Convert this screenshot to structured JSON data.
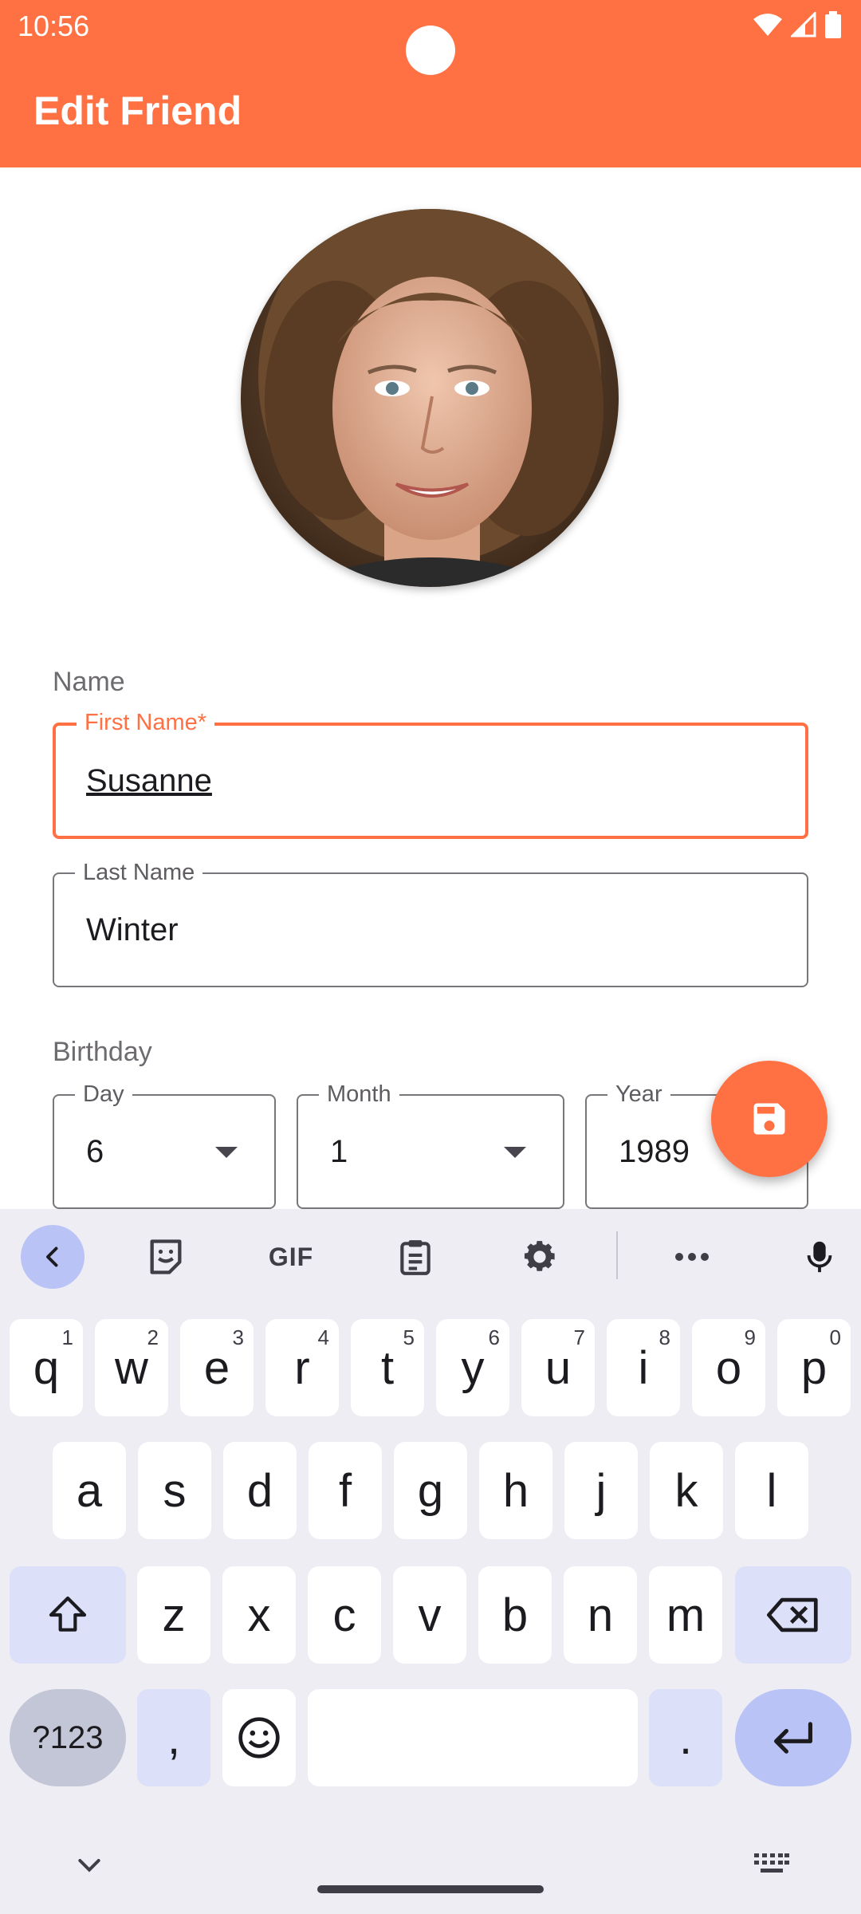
{
  "status_bar": {
    "time": "10:56"
  },
  "app_bar": {
    "title": "Edit Friend"
  },
  "form": {
    "name_section": "Name",
    "first_name": {
      "label": "First Name*",
      "value": "Susanne"
    },
    "last_name": {
      "label": "Last Name",
      "value": "Winter"
    },
    "birthday_section": "Birthday",
    "day": {
      "label": "Day",
      "value": "6"
    },
    "month": {
      "label": "Month",
      "value": "1"
    },
    "year": {
      "label": "Year",
      "value": "1989"
    }
  },
  "fab": {
    "icon": "save-icon"
  },
  "keyboard": {
    "toolbar": {
      "gif": "GIF"
    },
    "row1": [
      {
        "k": "q",
        "h": "1"
      },
      {
        "k": "w",
        "h": "2"
      },
      {
        "k": "e",
        "h": "3"
      },
      {
        "k": "r",
        "h": "4"
      },
      {
        "k": "t",
        "h": "5"
      },
      {
        "k": "y",
        "h": "6"
      },
      {
        "k": "u",
        "h": "7"
      },
      {
        "k": "i",
        "h": "8"
      },
      {
        "k": "o",
        "h": "9"
      },
      {
        "k": "p",
        "h": "0"
      }
    ],
    "row2": [
      "a",
      "s",
      "d",
      "f",
      "g",
      "h",
      "j",
      "k",
      "l"
    ],
    "row3": [
      "z",
      "x",
      "c",
      "v",
      "b",
      "n",
      "m"
    ],
    "symbols": "?123",
    "comma": ",",
    "period": "."
  },
  "colors": {
    "accent": "#ff7043",
    "keyboard_bg": "#eeedf4",
    "modifier_key": "#dce0f9"
  }
}
